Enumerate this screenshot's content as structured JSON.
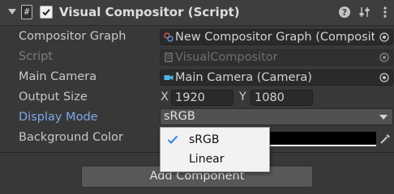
{
  "component": {
    "title": "Visual Compositor (Script)",
    "enabled": true,
    "script_icon_glyph": "#",
    "header_icons": [
      "help-icon",
      "presets-icon",
      "more-options-icon"
    ]
  },
  "fields": {
    "compositor_graph": {
      "label": "Compositor Graph",
      "value": "New Compositor Graph (Compositor Graph)",
      "icon": "compositor-graph-icon"
    },
    "script": {
      "label": "Script",
      "value": "VisualCompositor",
      "icon": "script-file-icon"
    },
    "main_camera": {
      "label": "Main Camera",
      "value": "Main Camera (Camera)",
      "icon": "camera-icon"
    },
    "output_size": {
      "label": "Output Size",
      "x_label": "X",
      "x_value": "1920",
      "y_label": "Y",
      "y_value": "1080"
    },
    "display_mode": {
      "label": "Display Mode",
      "value": "sRGB",
      "options": [
        "sRGB",
        "Linear"
      ],
      "selected_index": 0
    },
    "background_color": {
      "label": "Background Color",
      "color": "#000000"
    }
  },
  "add_component_label": "Add Component",
  "colors": {
    "background": "#383838",
    "header": "#3e3e3e",
    "accent_label": "#7aa8e8",
    "checkmark": "#3f87e0"
  }
}
